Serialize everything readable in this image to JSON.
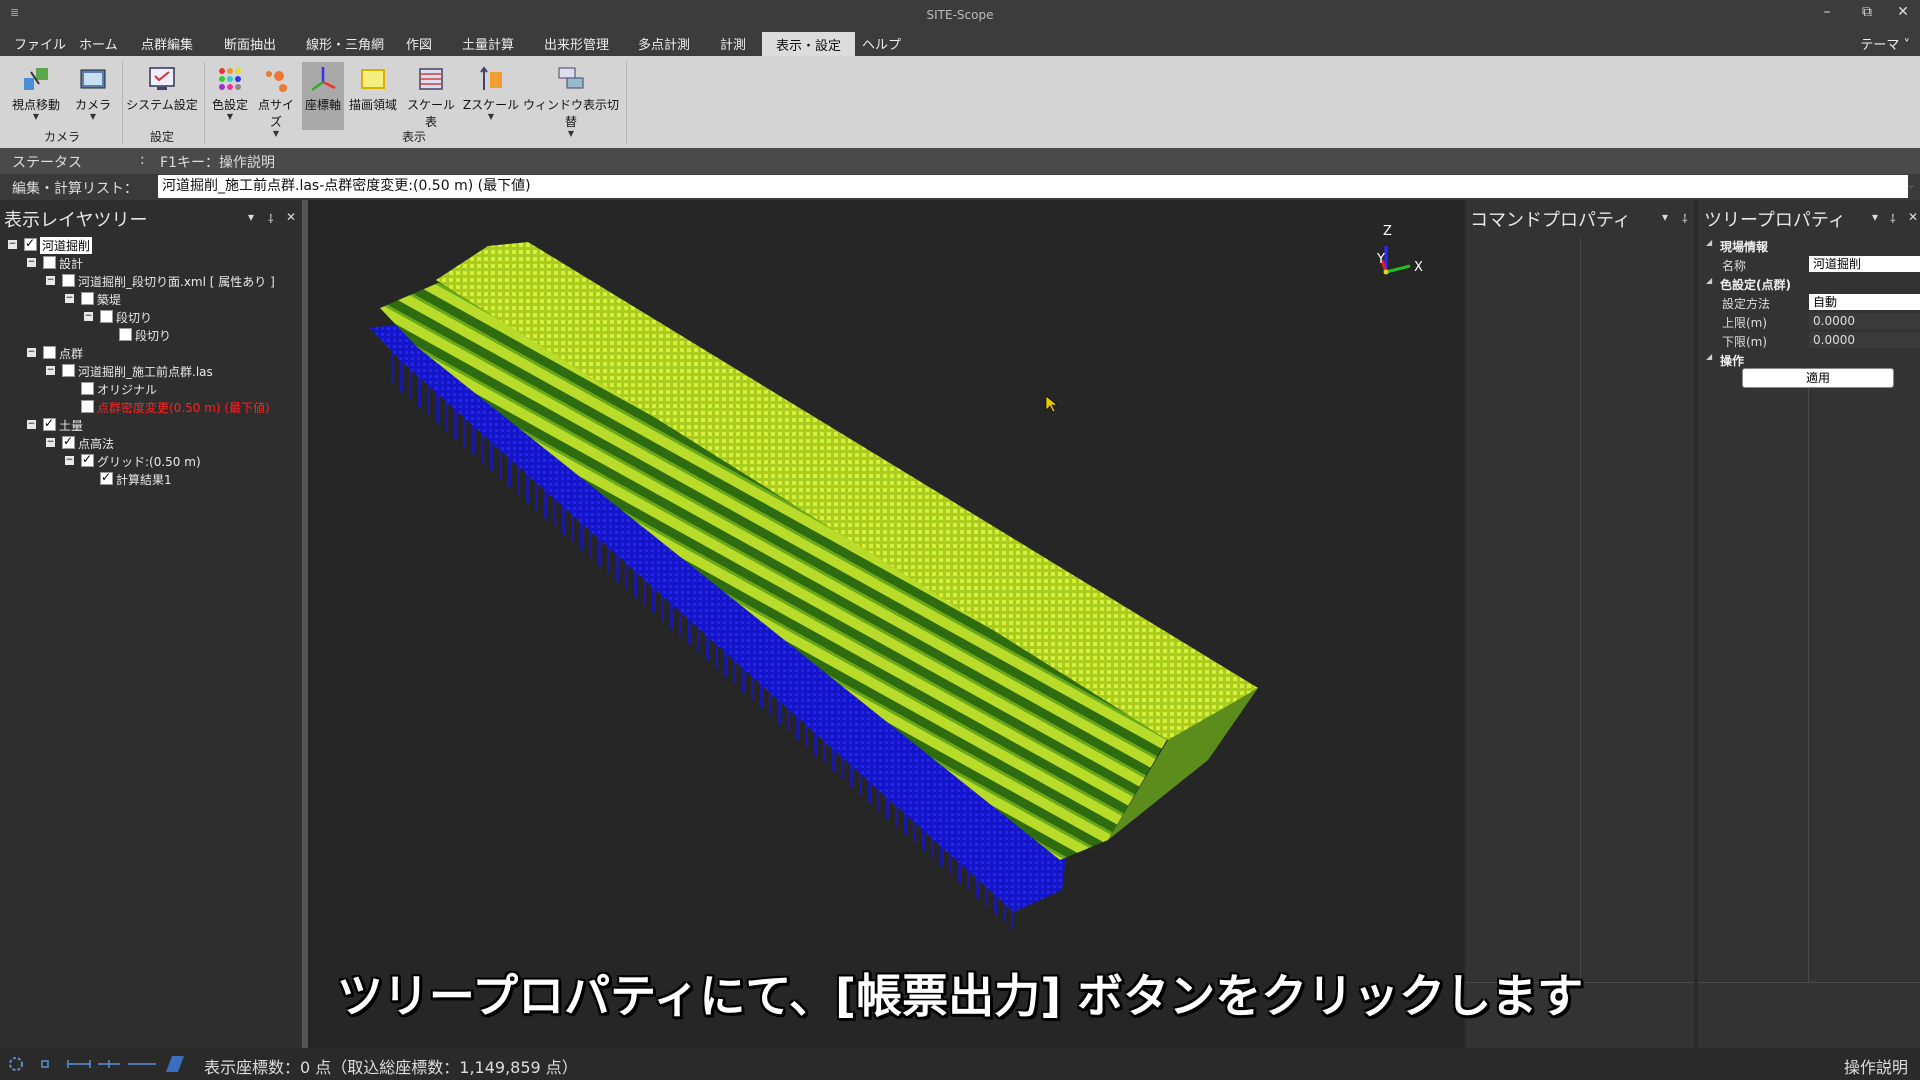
{
  "window": {
    "title": "SITE-Scope",
    "app_icon": "≣",
    "minimize": "–",
    "restore": "⧉",
    "close": "✕"
  },
  "menu": {
    "items": [
      "ファイル",
      "ホーム",
      "点群編集",
      "断面抽出",
      "線形・三角網",
      "作図",
      "土量計算",
      "出来形管理",
      "多点計測",
      "計測",
      "表示・設定",
      "ヘルプ"
    ],
    "active": "表示・設定",
    "theme": "テーマ ˅"
  },
  "ribbon": {
    "buttons": [
      {
        "label": "視点移動",
        "icon": "viewpoint-move-icon",
        "dropdown": true
      },
      {
        "label": "カメラ",
        "icon": "camera-icon",
        "dropdown": true
      },
      {
        "label": "システム設定",
        "icon": "system-settings-icon",
        "dropdown": false
      },
      {
        "label": "色設定",
        "icon": "color-settings-icon",
        "dropdown": true
      },
      {
        "label": "点サイズ",
        "icon": "point-size-icon",
        "dropdown": true
      },
      {
        "label": "座標軸",
        "icon": "coordinate-axis-icon",
        "dropdown": false,
        "active": true
      },
      {
        "label": "描画領域",
        "icon": "draw-area-icon",
        "dropdown": false
      },
      {
        "label": "スケール表",
        "icon": "scale-table-icon",
        "dropdown": false
      },
      {
        "label": "Zスケール",
        "icon": "z-scale-icon",
        "dropdown": true
      },
      {
        "label": "ウィンドウ表示切替",
        "icon": "window-toggle-icon",
        "dropdown": true
      }
    ],
    "groups": [
      "カメラ",
      "設定",
      "表示"
    ]
  },
  "status": {
    "label": "ステータス",
    "sep": ":",
    "text": "F1キー：操作説明"
  },
  "calc_list": {
    "label": "編集・計算リスト：",
    "value": "河道掘削_施工前点群.las-点群密度変更:(0.50 m) (最下値)"
  },
  "layer_tree": {
    "title": "表示レイヤツリー",
    "nodes": [
      {
        "label": "河道掘削",
        "checked": true,
        "expander": true,
        "selected": true
      },
      {
        "label": "設計",
        "checked": false,
        "expander": true
      },
      {
        "label": "河道掘削_段切り面.xml [ 属性あり ]",
        "checked": false,
        "expander": true
      },
      {
        "label": "築堤",
        "checked": false,
        "expander": true
      },
      {
        "label": "段切り",
        "checked": false,
        "expander": true
      },
      {
        "label": "段切り",
        "checked": false,
        "expander": false
      },
      {
        "label": "点群",
        "checked": false,
        "expander": true
      },
      {
        "label": "河道掘削_施工前点群.las",
        "checked": false,
        "expander": true
      },
      {
        "label": "オリジナル",
        "checked": false,
        "expander": false
      },
      {
        "label": "点群密度変更(0.50 m) (最下値)",
        "checked": false,
        "expander": false,
        "red": true
      },
      {
        "label": "土量",
        "checked": true,
        "expander": true
      },
      {
        "label": "点高法",
        "checked": true,
        "expander": true
      },
      {
        "label": "グリッド:(0.50 m)",
        "checked": true,
        "expander": true
      },
      {
        "label": "計算結果1",
        "checked": true,
        "expander": false
      }
    ]
  },
  "viewport": {
    "axis": {
      "z": "Z",
      "y": "Y",
      "x": "X"
    },
    "colors": {
      "background": "#262626",
      "lime": "#c8e62a",
      "green": "#4a8a14",
      "dark_green": "#1f4d0c",
      "blue": "#1a1ae0"
    }
  },
  "command_panel": {
    "title": "コマンドプロパティ"
  },
  "tree_property": {
    "title": "ツリープロパティ",
    "sections": [
      {
        "name": "現場情報",
        "rows": [
          {
            "key": "名称",
            "value": "河道掘削"
          }
        ]
      },
      {
        "name": "色設定(点群)",
        "rows": [
          {
            "key": "設定方法",
            "value": "自動"
          },
          {
            "key": "上限(m)",
            "value": "0.0000"
          },
          {
            "key": "下限(m)",
            "value": "0.0000"
          }
        ]
      },
      {
        "name": "操作",
        "rows": []
      }
    ],
    "apply_button": "適用"
  },
  "bottom": {
    "coords_text": "表示座標数：0 点（取込総座標数：1,149,859 点）",
    "help": "操作説明"
  },
  "subtitle": "ツリープロパティにて、[帳票出力] ボタンをクリックします",
  "panel_icons": {
    "dropdown": "▾",
    "pin": "⸸",
    "close": "✕"
  }
}
